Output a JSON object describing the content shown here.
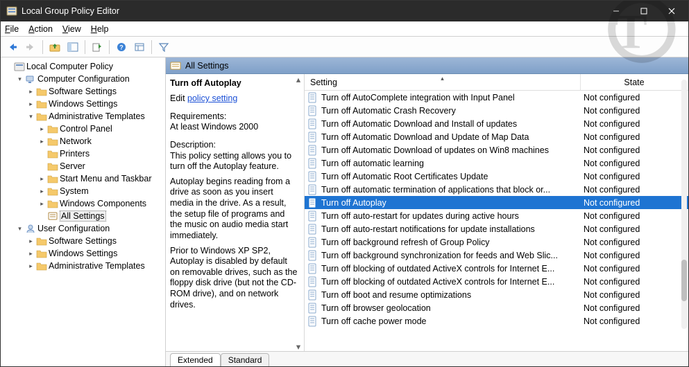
{
  "window": {
    "title": "Local Group Policy Editor"
  },
  "menubar": {
    "file": "File",
    "action": "Action",
    "view": "View",
    "help": "Help"
  },
  "tree": {
    "root": "Local Computer Policy",
    "computer_cfg": "Computer Configuration",
    "software": "Software Settings",
    "windows": "Windows Settings",
    "admin": "Administrative Templates",
    "control_panel": "Control Panel",
    "network": "Network",
    "printers": "Printers",
    "server": "Server",
    "start_taskbar": "Start Menu and Taskbar",
    "system": "System",
    "win_comp": "Windows Components",
    "all_settings": "All Settings",
    "user_cfg": "User Configuration",
    "u_software": "Software Settings",
    "u_windows": "Windows Settings",
    "u_admin": "Administrative Templates"
  },
  "header": {
    "title": "All Settings"
  },
  "desc": {
    "title": "Turn off Autoplay",
    "edit_prefix": "Edit ",
    "edit_link": "policy setting",
    "req_label": "Requirements:",
    "req_value": "At least Windows 2000",
    "desc_label": "Description:",
    "p1": "This policy setting allows you to turn off the Autoplay feature.",
    "p2": "      Autoplay begins reading from a drive as soon as you insert media in the drive. As a result, the setup file of programs and the music on audio media start immediately.",
    "p3": "      Prior to Windows XP SP2, Autoplay is disabled by default on removable drives, such as the floppy disk drive (but not the CD-ROM drive), and on network drives."
  },
  "columns": {
    "setting": "Setting",
    "state": "State"
  },
  "rows": [
    {
      "label": "Turn off AutoComplete integration with Input Panel",
      "state": "Not configured"
    },
    {
      "label": "Turn off Automatic Crash Recovery",
      "state": "Not configured"
    },
    {
      "label": "Turn off Automatic Download and Install of updates",
      "state": "Not configured"
    },
    {
      "label": "Turn off Automatic Download and Update of Map Data",
      "state": "Not configured"
    },
    {
      "label": "Turn off Automatic Download of updates on Win8 machines",
      "state": "Not configured"
    },
    {
      "label": "Turn off automatic learning",
      "state": "Not configured"
    },
    {
      "label": "Turn off Automatic Root Certificates Update",
      "state": "Not configured"
    },
    {
      "label": "Turn off automatic termination of applications that block or...",
      "state": "Not configured"
    },
    {
      "label": "Turn off Autoplay",
      "state": "Not configured",
      "selected": true
    },
    {
      "label": "Turn off auto-restart for updates during active hours",
      "state": "Not configured"
    },
    {
      "label": "Turn off auto-restart notifications for update installations",
      "state": "Not configured"
    },
    {
      "label": "Turn off background refresh of Group Policy",
      "state": "Not configured"
    },
    {
      "label": "Turn off background synchronization for feeds and Web Slic...",
      "state": "Not configured"
    },
    {
      "label": "Turn off blocking of outdated ActiveX controls for Internet E...",
      "state": "Not configured"
    },
    {
      "label": "Turn off blocking of outdated ActiveX controls for Internet E...",
      "state": "Not configured"
    },
    {
      "label": "Turn off boot and resume optimizations",
      "state": "Not configured"
    },
    {
      "label": "Turn off browser geolocation",
      "state": "Not configured"
    },
    {
      "label": "Turn off cache power mode",
      "state": "Not configured"
    }
  ],
  "tabs": {
    "extended": "Extended",
    "standard": "Standard"
  }
}
